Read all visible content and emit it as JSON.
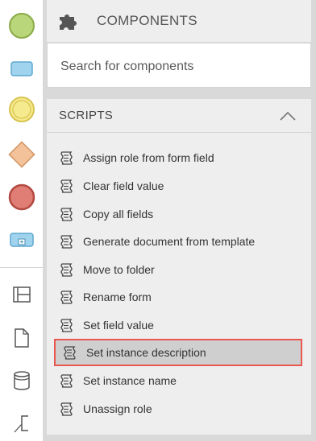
{
  "palette": {
    "items": [
      {
        "icon": "start-event-icon",
        "color": "#b9d77a"
      },
      {
        "icon": "task-icon",
        "color": "#9fd3ee"
      },
      {
        "icon": "intermediate-event-icon",
        "color": "#f6ea8e"
      },
      {
        "icon": "gateway-icon",
        "color": "#f3c29a"
      },
      {
        "icon": "end-event-icon",
        "color": "#e07d74"
      },
      {
        "icon": "subprocess-icon",
        "color": "#9fd3ee"
      },
      {
        "icon": "pool-lane-icon"
      },
      {
        "icon": "data-object-icon"
      },
      {
        "icon": "data-store-icon"
      },
      {
        "icon": "annotation-icon"
      }
    ]
  },
  "components": {
    "title": "COMPONENTS",
    "icon": "puzzle-icon",
    "search_placeholder": "Search for components"
  },
  "scripts": {
    "title": "SCRIPTS",
    "collapse_icon": "chevron-up-icon",
    "items": [
      {
        "label": "Assign role from form field"
      },
      {
        "label": "Clear field value"
      },
      {
        "label": "Copy all fields"
      },
      {
        "label": "Generate document from template"
      },
      {
        "label": "Move to folder"
      },
      {
        "label": "Rename form"
      },
      {
        "label": "Set field value"
      },
      {
        "label": "Set instance description",
        "highlighted": true
      },
      {
        "label": "Set instance name"
      },
      {
        "label": "Unassign role"
      }
    ]
  },
  "colors": {
    "highlight_border": "#e8584f",
    "panel_bg": "#eeeeee"
  }
}
